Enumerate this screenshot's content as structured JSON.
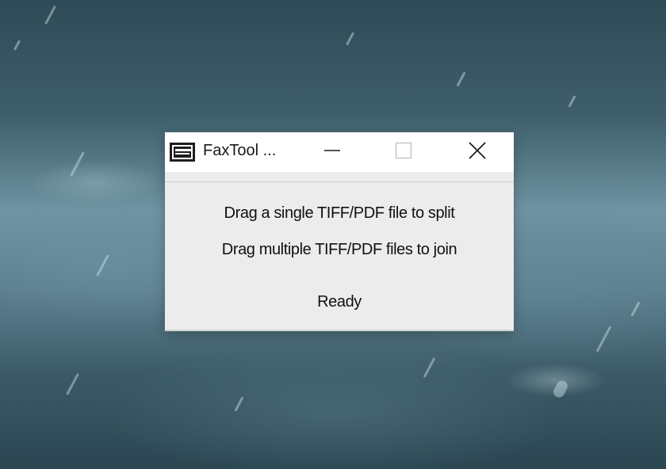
{
  "window": {
    "title": "FaxTool ...",
    "controls": {
      "minimize": "minimize-icon",
      "maximize": "maximize-icon",
      "close": "close-icon"
    }
  },
  "content": {
    "instruction_split": "Drag a single  TIFF/PDF file to split",
    "instruction_join": "Drag multiple  TIFF/PDF files to join",
    "status": "Ready"
  },
  "colors": {
    "window_background": "#ececec",
    "titlebar_background": "#ffffff",
    "text": "#111111"
  }
}
